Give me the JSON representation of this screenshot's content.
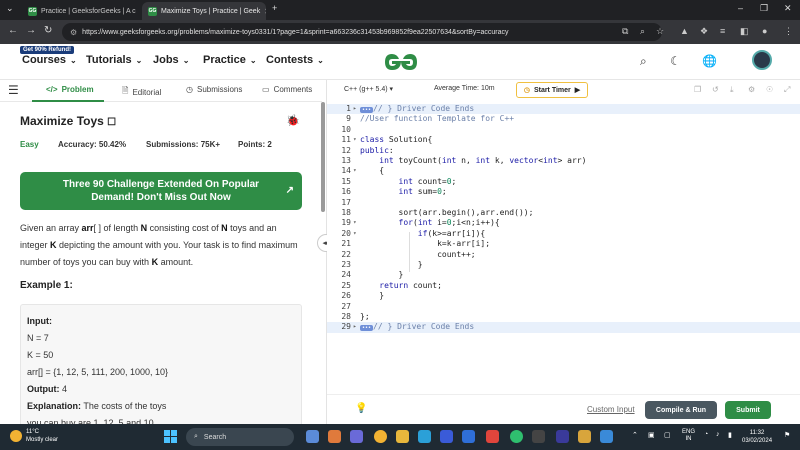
{
  "browser": {
    "tabs": [
      {
        "title": "Practice | GeeksforGeeks | A c",
        "active": false
      },
      {
        "title": "Maximize Toys | Practice | Geek",
        "active": true
      }
    ],
    "url": "https://www.geeksforgeeks.org/problems/maximize-toys0331/1?page=1&sprint=a663236c31453b969852f9ea22507634&sortBy=accuracy"
  },
  "header": {
    "promo": "Get 90% Refund!",
    "nav": [
      "Courses",
      "Tutorials",
      "Jobs",
      "Practice",
      "Contests"
    ],
    "brand_color": "#2f8d46"
  },
  "problem_tabs": [
    "Problem",
    "Editorial",
    "Submissions",
    "Comments"
  ],
  "problem": {
    "title": "Maximize Toys",
    "difficulty": "Easy",
    "accuracy_label": "Accuracy:",
    "accuracy": "50.42%",
    "submissions_label": "Submissions:",
    "submissions": "75K+",
    "points_label": "Points:",
    "points": "2",
    "banner": "Three 90 Challenge Extended On Popular Demand! Don't Miss Out Now",
    "description": {
      "p1": "Given an array ",
      "arr": "arr",
      "p2": "[ ] of length ",
      "n": "N",
      "p3": " consisting cost of ",
      "n2": "N",
      "p4": " toys and an integer ",
      "k": "K",
      "p5": " depicting the amount with you. Your task is to find maximum number of toys you can buy with ",
      "k2": "K",
      "p6": " amount."
    },
    "example_title": "Example 1:",
    "example": {
      "input_label": "Input:",
      "n_line": "N = 7",
      "k_line": "K = 50",
      "arr_line": "arr[] = {1, 12, 5, 111, 200, 1000, 10}",
      "output_label": "Output:",
      "output_value": "4",
      "explanation_label": "Explanation:",
      "explanation_l1": "The costs of the toys",
      "explanation_l2": "you can buy are 1, 12, 5 and 10."
    }
  },
  "editor": {
    "language": "C++ (g++ 5.4)",
    "avg_time": "Average Time: 10m",
    "timer_label": "Start Timer",
    "lines": [
      {
        "n": "1",
        "fold": "▸",
        "tag": "•••",
        "text": "// } Driver Code Ends",
        "cls": "cm",
        "hl": true
      },
      {
        "n": "9",
        "fold": "",
        "text": "//User function Template for C++",
        "cls": "cm"
      },
      {
        "n": "10",
        "fold": "",
        "text": ""
      },
      {
        "n": "11",
        "fold": "▾",
        "text": "class Solution{"
      },
      {
        "n": "12",
        "fold": "",
        "text": "public:"
      },
      {
        "n": "13",
        "fold": "",
        "text": "    int toyCount(int n, int k, vector<int> arr)"
      },
      {
        "n": "14",
        "fold": "▾",
        "text": "    {"
      },
      {
        "n": "15",
        "fold": "",
        "text": "        int count=0;"
      },
      {
        "n": "16",
        "fold": "",
        "text": "        int sum=0;"
      },
      {
        "n": "17",
        "fold": "",
        "text": ""
      },
      {
        "n": "18",
        "fold": "",
        "text": "        sort(arr.begin(),arr.end());"
      },
      {
        "n": "19",
        "fold": "▾",
        "text": "        for(int i=0;i<n;i++){"
      },
      {
        "n": "20",
        "fold": "▾",
        "text": "            if(k>=arr[i]){"
      },
      {
        "n": "21",
        "fold": "",
        "text": "                k=k-arr[i];"
      },
      {
        "n": "22",
        "fold": "",
        "text": "                count++;"
      },
      {
        "n": "23",
        "fold": "",
        "text": "            }"
      },
      {
        "n": "24",
        "fold": "",
        "text": "        }"
      },
      {
        "n": "25",
        "fold": "",
        "text": "    return count;"
      },
      {
        "n": "26",
        "fold": "",
        "text": "    }"
      },
      {
        "n": "27",
        "fold": "",
        "text": ""
      },
      {
        "n": "28",
        "fold": "",
        "text": "};"
      },
      {
        "n": "29",
        "fold": "▸",
        "tag": "•••",
        "text": "// } Driver Code Ends",
        "cls": "cm",
        "hl": true
      }
    ],
    "custom_input": "Custom Input",
    "compile_label": "Compile & Run",
    "submit_label": "Submit"
  },
  "taskbar": {
    "temp": "11°C",
    "weather": "Mostly clear",
    "search": "Search",
    "lang": "ENG",
    "region": "IN",
    "time": "11:32",
    "date": "03/02/2024"
  }
}
